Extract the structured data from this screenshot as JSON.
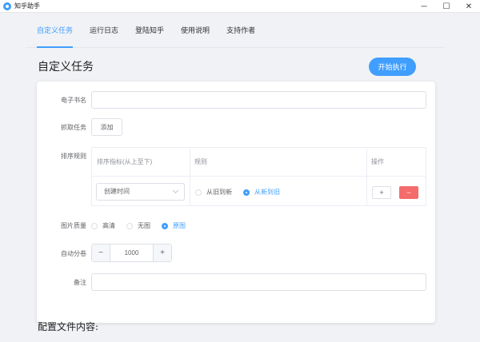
{
  "window": {
    "title": "知乎助手",
    "minimize": "─",
    "maximize": "☐",
    "close": "✕"
  },
  "tabs": [
    {
      "label": "自定义任务",
      "active": true
    },
    {
      "label": "运行日志",
      "active": false
    },
    {
      "label": "登陆知乎",
      "active": false
    },
    {
      "label": "使用说明",
      "active": false
    },
    {
      "label": "支持作者",
      "active": false
    }
  ],
  "task": {
    "title": "自定义任务",
    "start_label": "开始执行"
  },
  "form": {
    "ebook_label": "电子书名",
    "ebook_value": "",
    "fetch_label": "抓取任务",
    "add_label": "添加",
    "sort_label": "排序规则",
    "sort_table": {
      "headers": [
        "排序指标(从上至下)",
        "规则",
        "操作"
      ],
      "row": {
        "metric": "创建时间",
        "rules": [
          {
            "label": "从旧到新",
            "checked": false
          },
          {
            "label": "从新到旧",
            "checked": true
          }
        ],
        "add": "+",
        "remove": "−"
      }
    },
    "image_label": "图片质量",
    "image_options": [
      {
        "label": "高清",
        "checked": false
      },
      {
        "label": "无图",
        "checked": false
      },
      {
        "label": "原图",
        "checked": true
      }
    ],
    "split_label": "自动分卷",
    "split_value": "1000",
    "step_minus": "−",
    "step_plus": "+",
    "note_label": "备注",
    "note_value": ""
  },
  "config": {
    "title": "配置文件内容:"
  },
  "colors": {
    "accent": "#409eff",
    "danger": "#f56c6c"
  }
}
